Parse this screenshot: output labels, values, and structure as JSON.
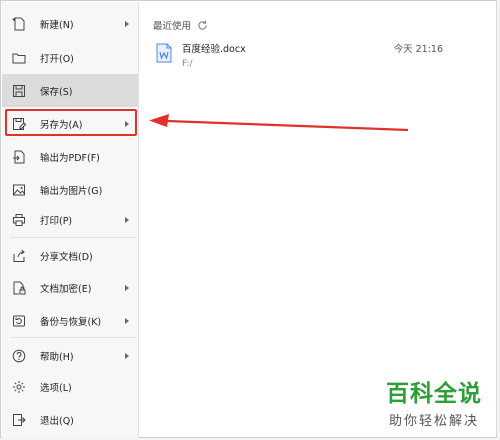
{
  "menu": {
    "items": [
      {
        "label": "新建(N)",
        "icon": "new-file-icon",
        "submenu": true
      },
      {
        "label": "打开(O)",
        "icon": "folder-icon",
        "submenu": false
      },
      {
        "label": "保存(S)",
        "icon": "save-icon",
        "submenu": false
      },
      {
        "label": "另存为(A)",
        "icon": "save-as-icon",
        "submenu": true
      },
      {
        "label": "输出为PDF(F)",
        "icon": "export-pdf-icon",
        "submenu": false
      },
      {
        "label": "输出为图片(G)",
        "icon": "export-image-icon",
        "submenu": false
      },
      {
        "label": "打印(P)",
        "icon": "printer-icon",
        "submenu": true
      },
      {
        "label": "分享文档(D)",
        "icon": "share-icon",
        "submenu": false
      },
      {
        "label": "文档加密(E)",
        "icon": "encrypt-icon",
        "submenu": true
      },
      {
        "label": "备份与恢复(K)",
        "icon": "backup-icon",
        "submenu": true
      },
      {
        "label": "帮助(H)",
        "icon": "help-icon",
        "submenu": true
      },
      {
        "label": "选项(L)",
        "icon": "gear-icon",
        "submenu": false
      },
      {
        "label": "退出(Q)",
        "icon": "exit-icon",
        "submenu": false
      }
    ],
    "active_index": 2,
    "highlighted_index": 3
  },
  "recent": {
    "title": "最近使用",
    "files": [
      {
        "name": "百度经验.docx",
        "path": "F:/",
        "time": "今天 21:16"
      }
    ]
  },
  "watermark": {
    "title": "百科全说",
    "subtitle": "助你轻松解决"
  },
  "colors": {
    "highlight_border": "#e0322a",
    "annotation_arrow": "#e0322a",
    "watermark_green": "#2e9e37",
    "doc_icon_blue": "#4a86e8"
  }
}
